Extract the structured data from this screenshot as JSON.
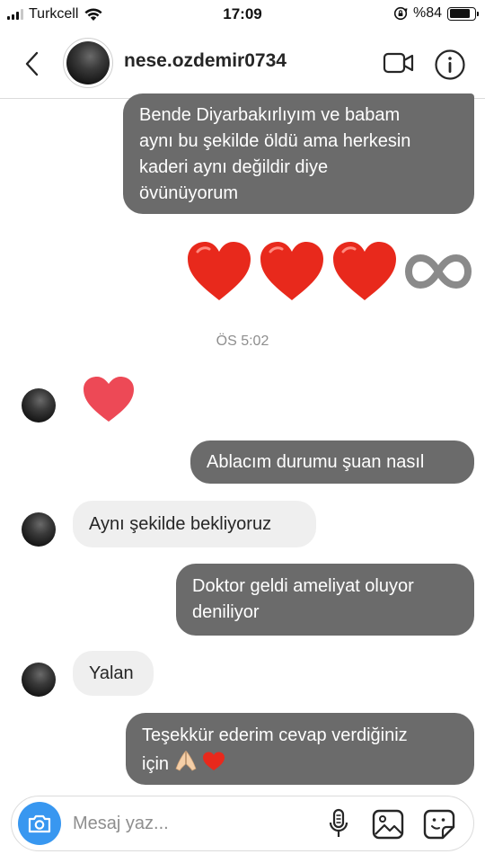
{
  "status_bar": {
    "carrier": "Turkcell",
    "time": "17:09",
    "battery_text": "%84",
    "battery_level": 0.84,
    "icons": [
      "signal-icon",
      "wifi-icon",
      "orientation-lock-icon",
      "battery-icon"
    ]
  },
  "header": {
    "username": "nese.ozdemir0734",
    "icons": [
      "back-chevron-icon",
      "video-call-icon",
      "info-icon"
    ]
  },
  "messages": [
    {
      "direction": "sent",
      "lines": [
        "Bende Diyarbakırlıyım ve babam",
        "aynı bu şekilde öldü ama herkesin",
        "kaderi aynı değildir diye",
        "övünüyorum"
      ]
    },
    {
      "direction": "sent",
      "type": "emoji",
      "content": [
        "red-heart-icon",
        "red-heart-icon",
        "red-heart-icon",
        "infinity-icon"
      ]
    },
    {
      "type": "timestamp",
      "text": "ÖS 5:02"
    },
    {
      "direction": "received",
      "type": "emoji",
      "content": [
        "heart-reaction-icon"
      ]
    },
    {
      "direction": "sent",
      "text": "Ablacım durumu şuan nasıl"
    },
    {
      "direction": "received",
      "text": "Aynı şekilde bekliyoruz"
    },
    {
      "direction": "sent",
      "lines": [
        "Doktor geldi ameliyat oluyor",
        "deniliyor"
      ]
    },
    {
      "direction": "received",
      "text": "Yalan"
    },
    {
      "direction": "sent",
      "lines": [
        "Teşekkür ederim cevap verdiğiniz",
        "için"
      ],
      "trailing_icons": [
        "praying-hands-icon",
        "red-heart-icon"
      ]
    }
  ],
  "composer": {
    "placeholder": "Mesaj yaz...",
    "icons": [
      "camera-icon",
      "microphone-icon",
      "gallery-icon",
      "sticker-icon"
    ]
  },
  "colors": {
    "sent_bubble": "#6b6b6b",
    "received_bubble": "#efefef",
    "heart_red": "#e8291c",
    "camera_blue": "#3897f0"
  }
}
